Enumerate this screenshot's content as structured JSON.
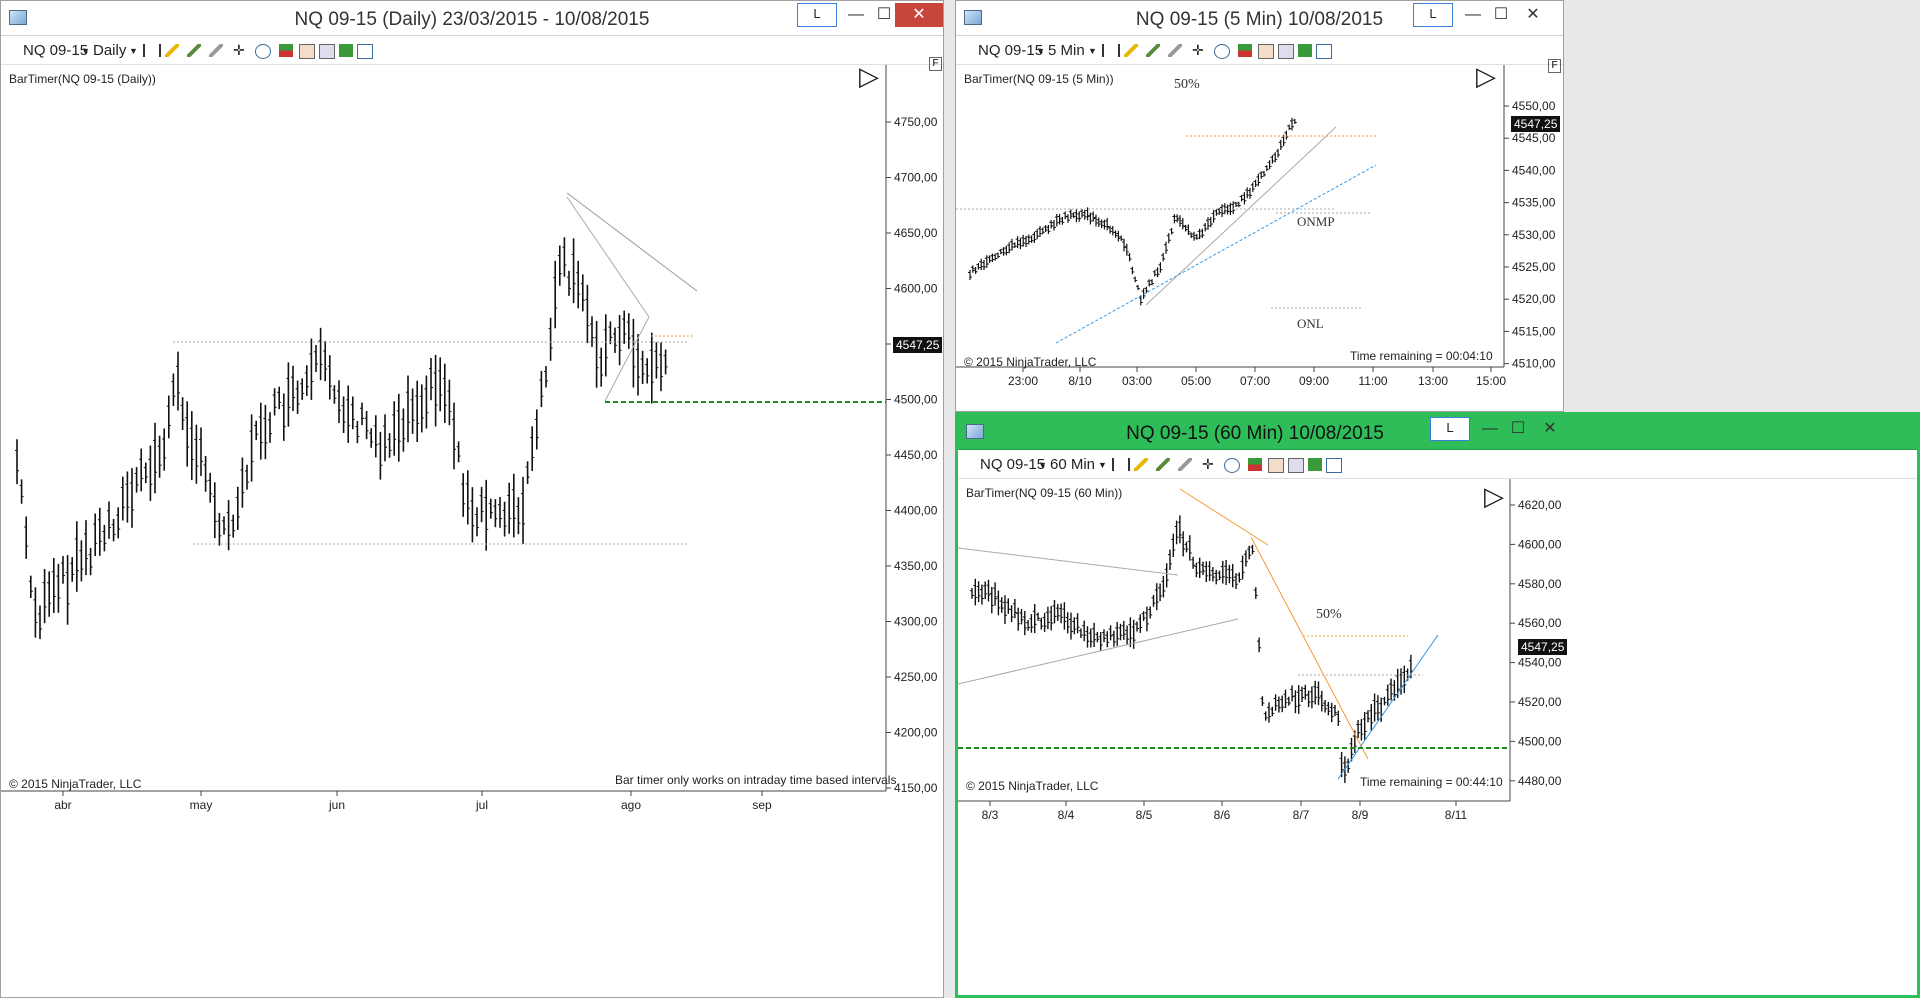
{
  "windows": {
    "daily": {
      "title": "NQ 09-15 (Daily)  23/03/2015 - 10/08/2015",
      "instrument": "NQ 09-15",
      "interval": "Daily",
      "lbtn": "L",
      "indicator": "BarTimer(NQ 09-15 (Daily))",
      "copyright": "© 2015 NinjaTrader, LLC",
      "message": "Bar timer only works on intraday time based intervals",
      "price_tag": "4547,25",
      "f_label": "F",
      "y_ticks": [
        "4750,00",
        "4700,00",
        "4650,00",
        "4600,00",
        "4550,00",
        "4500,00",
        "4450,00",
        "4400,00",
        "4350,00",
        "4300,00",
        "4250,00",
        "4200,00",
        "4150,00"
      ],
      "x_ticks": [
        "abr",
        "may",
        "jun",
        "jul",
        "ago",
        "sep"
      ]
    },
    "min5": {
      "title": "NQ 09-15 (5 Min)  10/08/2015",
      "instrument": "NQ 09-15",
      "interval": "5 Min",
      "lbtn": "L",
      "indicator": "BarTimer(NQ 09-15 (5 Min))",
      "copyright": "© 2015 NinjaTrader, LLC",
      "time_remaining": "Time remaining = 00:04:10",
      "price_tag": "4547,25",
      "f_label": "F",
      "label_50": "50%",
      "label_onmp": "ONMP",
      "label_onl": "ONL",
      "y_ticks": [
        "4550,00",
        "4545,00",
        "4540,00",
        "4535,00",
        "4530,00",
        "4525,00",
        "4520,00",
        "4515,00",
        "4510,00"
      ],
      "x_ticks": [
        "23:00",
        "8/10",
        "03:00",
        "05:00",
        "07:00",
        "09:00",
        "11:00",
        "13:00",
        "15:00"
      ]
    },
    "min60": {
      "title": "NQ 09-15 (60 Min)  10/08/2015",
      "instrument": "NQ 09-15",
      "interval": "60 Min",
      "lbtn": "L",
      "indicator": "BarTimer(NQ 09-15 (60 Min))",
      "copyright": "© 2015 NinjaTrader, LLC",
      "time_remaining": "Time remaining = 00:44:10",
      "price_tag": "4547,25",
      "label_50": "50%",
      "y_ticks": [
        "4620,00",
        "4600,00",
        "4580,00",
        "4560,00",
        "4540,00",
        "4520,00",
        "4500,00",
        "4480,00"
      ],
      "x_ticks": [
        "8/3",
        "8/4",
        "8/5",
        "8/6",
        "8/7",
        "8/9",
        "8/11"
      ]
    }
  },
  "icons": {
    "minimize": "—",
    "maximize": "☐",
    "close": "✕",
    "play": "▷"
  },
  "colors": {
    "active_border": "#2ebd59",
    "close_button": "#c8453b",
    "orange_line": "#f39c33",
    "blue_line": "#3a98e0",
    "green_dashed": "#1f8a1f"
  }
}
